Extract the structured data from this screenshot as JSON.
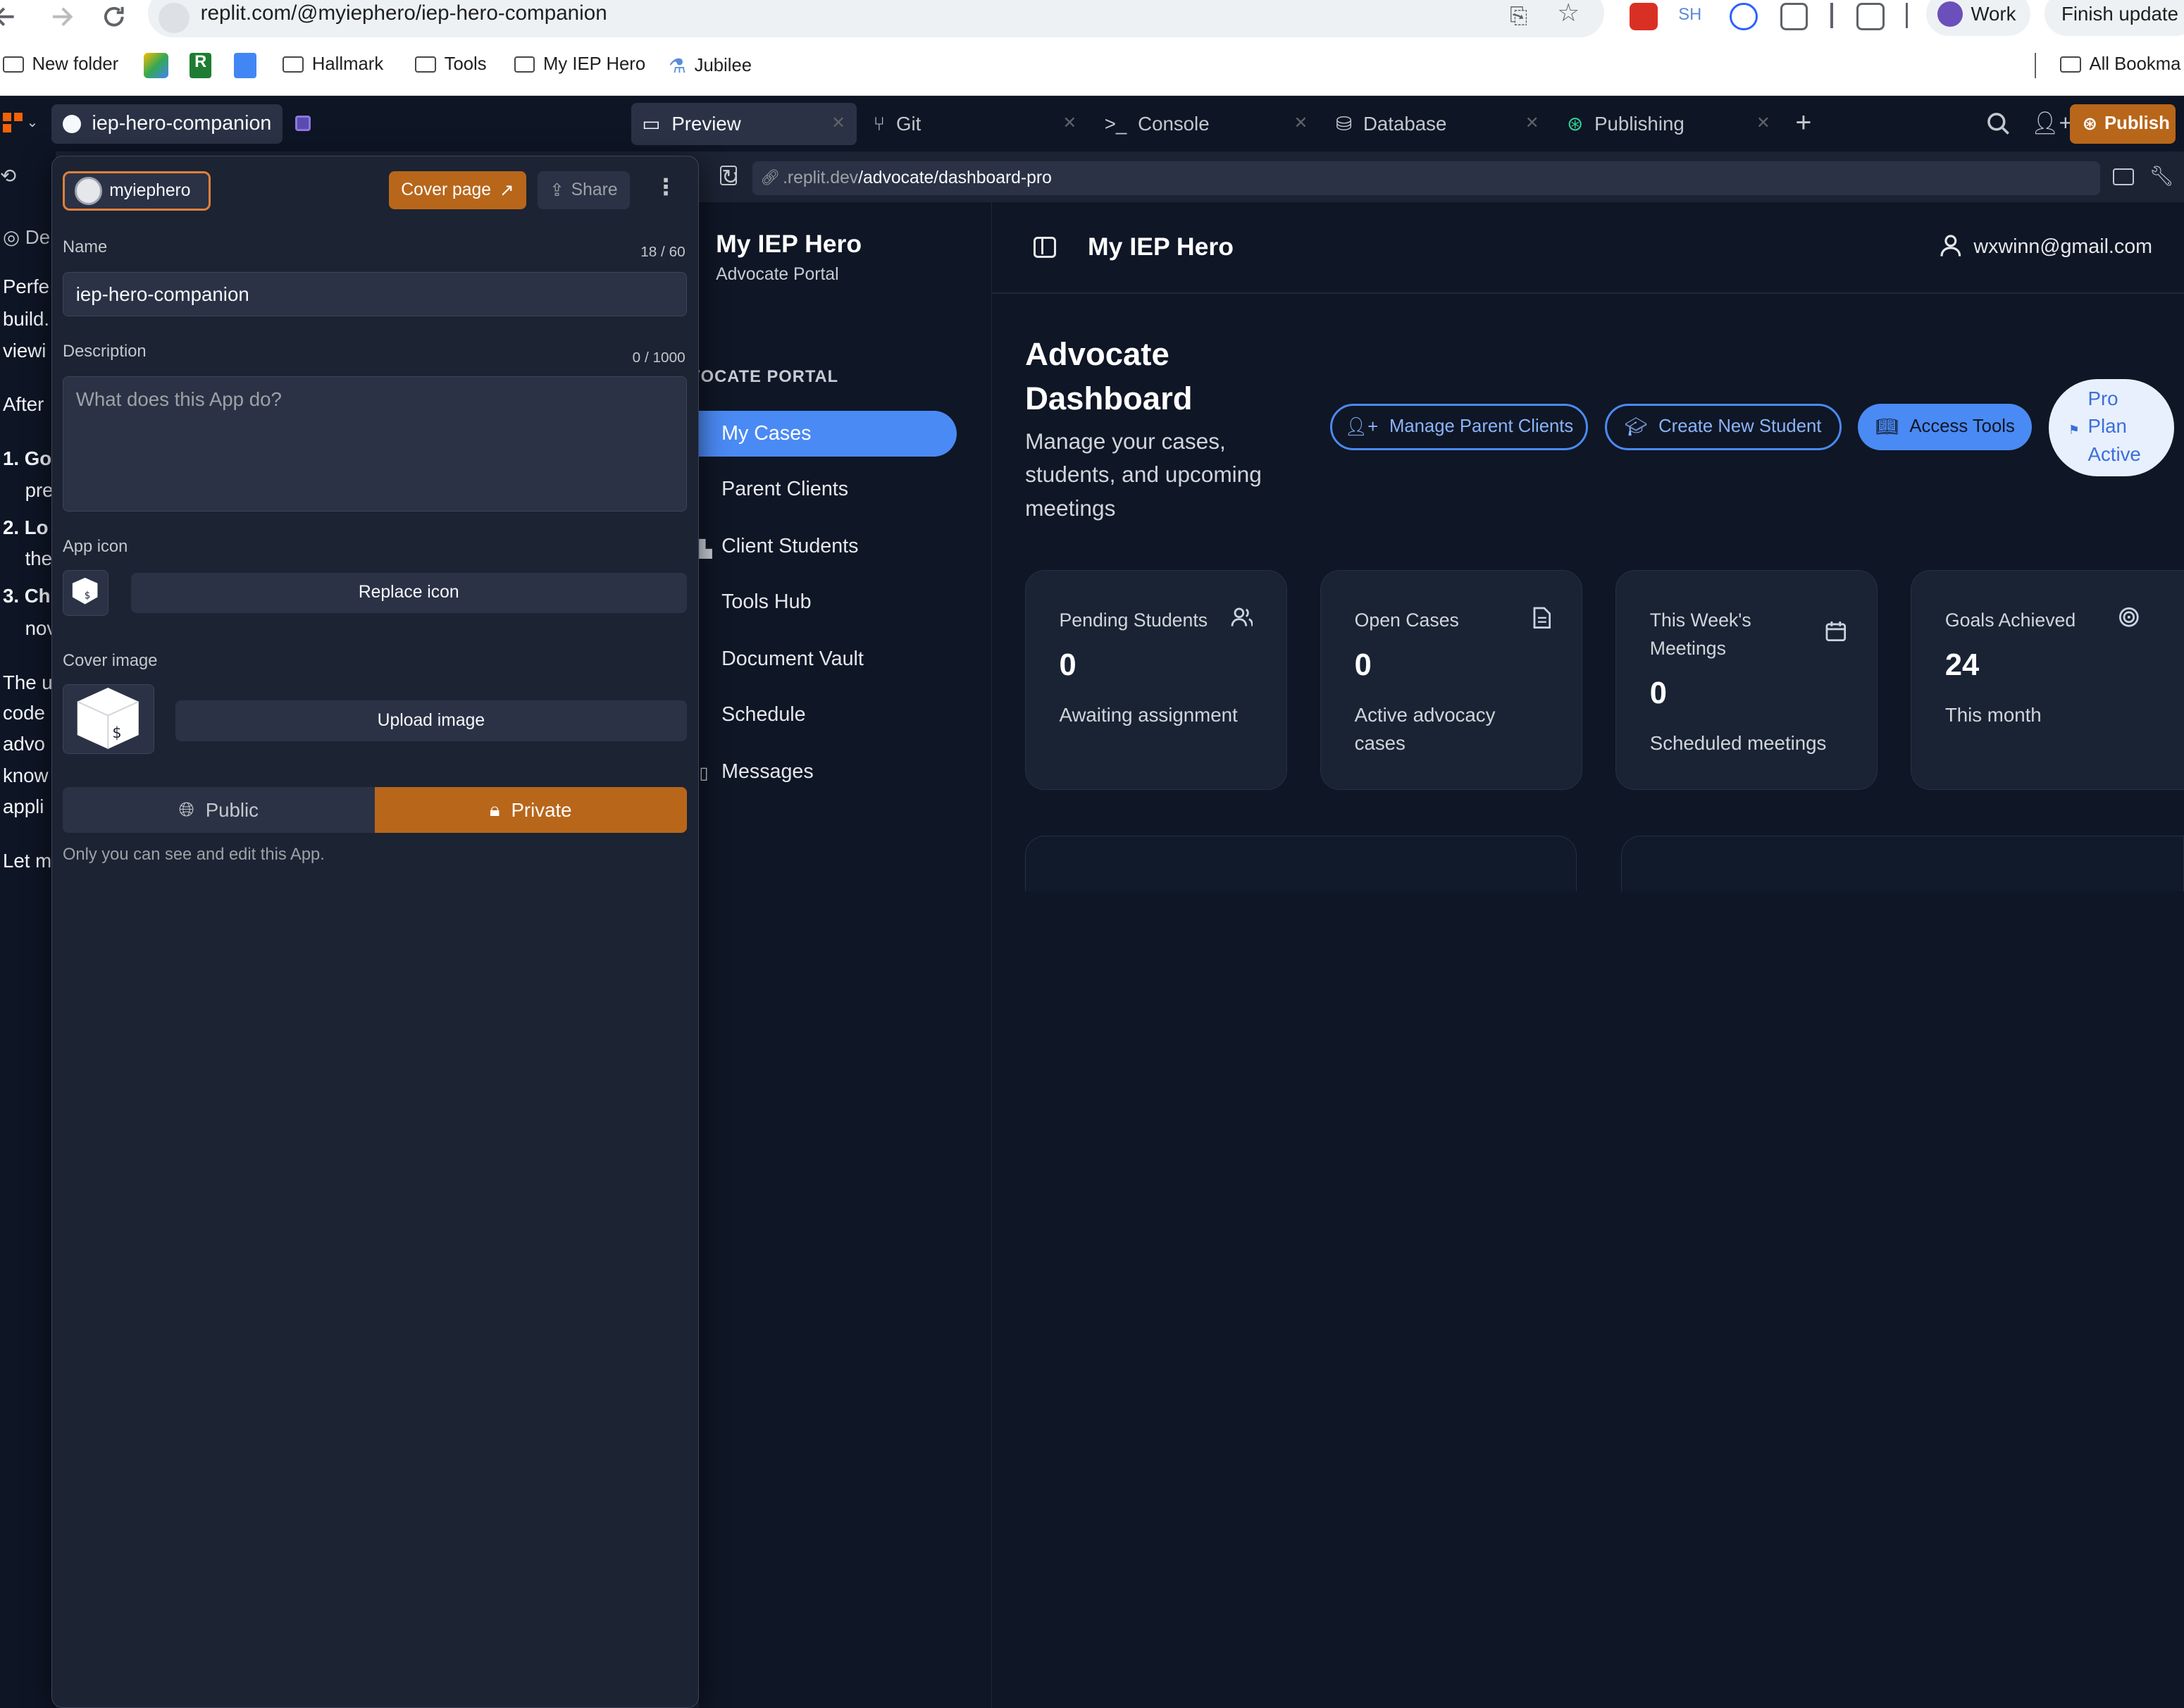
{
  "browser": {
    "url": "replit.com/@myiephero/iep-hero-companion",
    "profile_label": "Work",
    "update_label": "Finish update",
    "ext_sh": "SH",
    "bookmarks": [
      {
        "label": "New folder",
        "icon": "folder-icon"
      },
      {
        "label": "Hallmark",
        "icon": "folder-icon"
      },
      {
        "label": "Tools",
        "icon": "folder-icon"
      },
      {
        "label": "My IEP Hero",
        "icon": "folder-icon"
      },
      {
        "label": "Jubilee",
        "icon": "jubilee-icon"
      }
    ],
    "all_bookmarks": "All Bookma"
  },
  "replit": {
    "repl_name": "iep-hero-companion",
    "tabs": [
      {
        "label": "Preview",
        "icon": "monitor-icon"
      },
      {
        "label": "Git",
        "icon": "git-icon"
      },
      {
        "label": "Console",
        "icon": "terminal-icon"
      },
      {
        "label": "Database",
        "icon": "database-icon"
      },
      {
        "label": "Publishing",
        "icon": "publishing-icon"
      }
    ],
    "publish_label": "Publish"
  },
  "left_panel_text": {
    "de": "De",
    "line1": "Perfe",
    "line2": "build.",
    "line3": "viewi",
    "after": "After",
    "n1": "1. Go",
    "n1b": "pre",
    "n2": "2. Lo",
    "n2b": "the",
    "n3": "3. Ch",
    "n3b": "nov",
    "p1": "The u",
    "p2": "code",
    "p3": "advo",
    "p4": "know",
    "p5": "appli",
    "p6": "Let m"
  },
  "popup": {
    "owner": "myiephero",
    "cover_page_label": "Cover page",
    "share_label": "Share",
    "name_label": "Name",
    "name_count": "18 / 60",
    "name_value": "iep-hero-companion",
    "description_label": "Description",
    "description_count": "0 / 1000",
    "description_placeholder": "What does this App do?",
    "app_icon_label": "App icon",
    "replace_icon_label": "Replace icon",
    "cover_image_label": "Cover image",
    "upload_image_label": "Upload image",
    "public_label": "Public",
    "private_label": "Private",
    "visibility_note": "Only you can see and edit this App."
  },
  "preview": {
    "address_prefix": ".replit.dev",
    "address_path": "/advocate/dashboard-pro",
    "app": {
      "brand": "My IEP Hero",
      "brand_sub": "Advocate Portal",
      "section_label": "ADVOCATE PORTAL",
      "nav": [
        "My Cases",
        "Parent Clients",
        "Client Students",
        "Tools Hub",
        "Document Vault",
        "Schedule",
        "Messages"
      ],
      "header_title": "My IEP Hero",
      "user_email": "wxwinn@gmail.com",
      "dashboard_title_1": "Advocate",
      "dashboard_title_2": "Dashboard",
      "dashboard_subtitle_1": "Manage your cases,",
      "dashboard_subtitle_2": "students, and upcoming",
      "dashboard_subtitle_3": "meetings",
      "actions": [
        "Manage Parent Clients",
        "Create New Student",
        "Access Tools"
      ],
      "pro_badge": [
        "Pro",
        "Plan",
        "Active"
      ],
      "stats": [
        {
          "title": "Pending Students",
          "value": "0",
          "subtitle": "Awaiting assignment",
          "icon": "users-icon"
        },
        {
          "title": "Open Cases",
          "value": "0",
          "subtitle": "Active advocacy cases",
          "icon": "file-icon"
        },
        {
          "title": "This Week's Meetings",
          "value": "0",
          "subtitle": "Scheduled meetings",
          "icon": "calendar-icon"
        },
        {
          "title": "Goals Achieved",
          "value": "24",
          "subtitle": "This month",
          "icon": "target-icon"
        }
      ]
    }
  },
  "colors": {
    "accent_orange": "#b8661a",
    "accent_blue": "#4a8af4",
    "bg_dark": "#0f1625"
  }
}
